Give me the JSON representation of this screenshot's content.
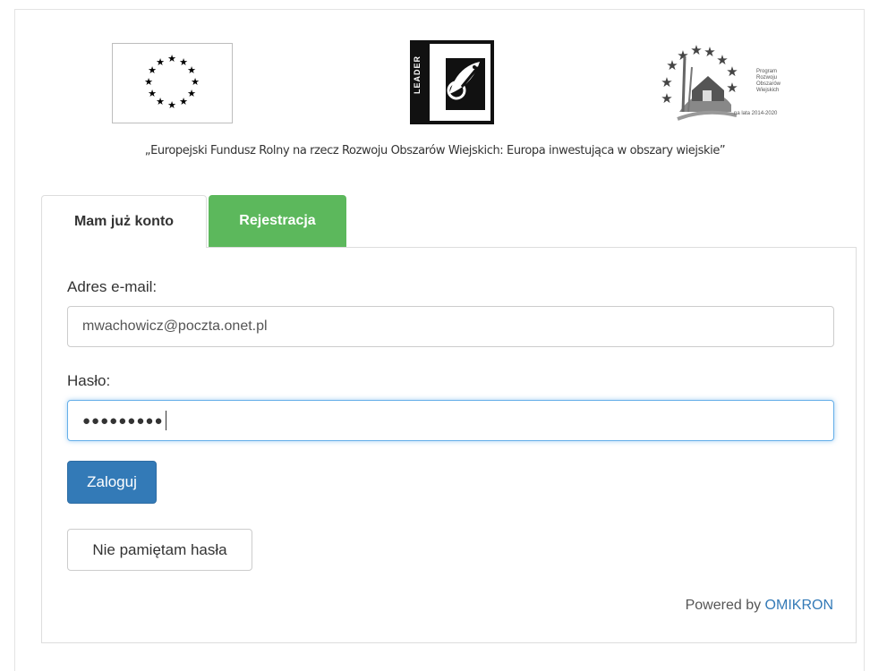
{
  "logos": {
    "eu": "eu-flag-logo",
    "leader": "leader-logo",
    "prow": "prow-logo",
    "prow_text_lines": [
      "Program",
      "Rozwoju",
      "Obszarów",
      "Wiejskich"
    ],
    "prow_years": "na lata 2014-2020",
    "leader_word": "LEADER"
  },
  "caption": "„Europejski Fundusz Rolny na rzecz Rozwoju Obszarów Wiejskich: Europa inwestująca w obszary wiejskie”",
  "tabs": [
    {
      "label": "Mam już konto",
      "active": true
    },
    {
      "label": "Rejestracja",
      "active": false,
      "color": "#5cb85c"
    }
  ],
  "form": {
    "email_label": "Adres e-mail:",
    "email_value": "mwachowicz@poczta.onet.pl",
    "password_label": "Hasło:",
    "password_value": "●●●●●●●●●",
    "login_button": "Zaloguj",
    "forgot_button": "Nie pamiętam hasła"
  },
  "footer": {
    "powered_prefix": "Powered by",
    "powered_brand": "OMIKRON"
  },
  "colors": {
    "primary": "#337ab7",
    "success": "#5cb85c",
    "focus": "#66afe9"
  }
}
